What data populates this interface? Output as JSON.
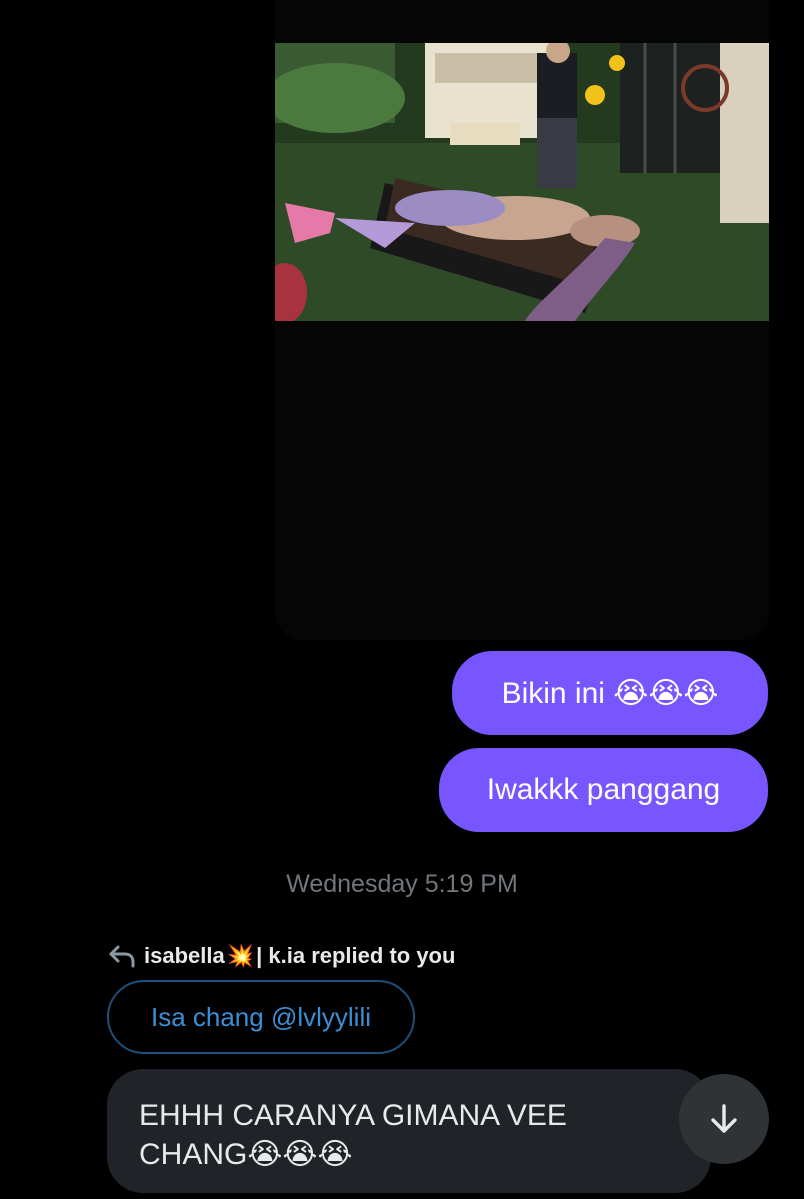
{
  "conversation": {
    "media": {
      "image_icon": "game-screenshot-mermaid-on-grill"
    },
    "sent_messages": [
      {
        "text": "Bikin ini 😭😭😭"
      },
      {
        "text": "Iwakkk panggang"
      }
    ],
    "timestamp": "Wednesday 5:19 PM",
    "reply": {
      "icon": "reply-arrow-icon",
      "author": "isabella",
      "author_emoji": "💥",
      "suffix": "| k.ia replied to you",
      "quoted_text": "Isa chang @lvlyylili"
    },
    "received_message": {
      "line1": "EHHH CARANYA GIMANA VEE",
      "line2": "CHANG😭😭😭"
    },
    "scroll_button_icon": "arrow-down-icon"
  },
  "colors": {
    "background": "#000000",
    "sent_bubble": "#7856ff",
    "received_bubble": "#202327",
    "link": "#3b8fd6",
    "muted": "#71767b"
  }
}
